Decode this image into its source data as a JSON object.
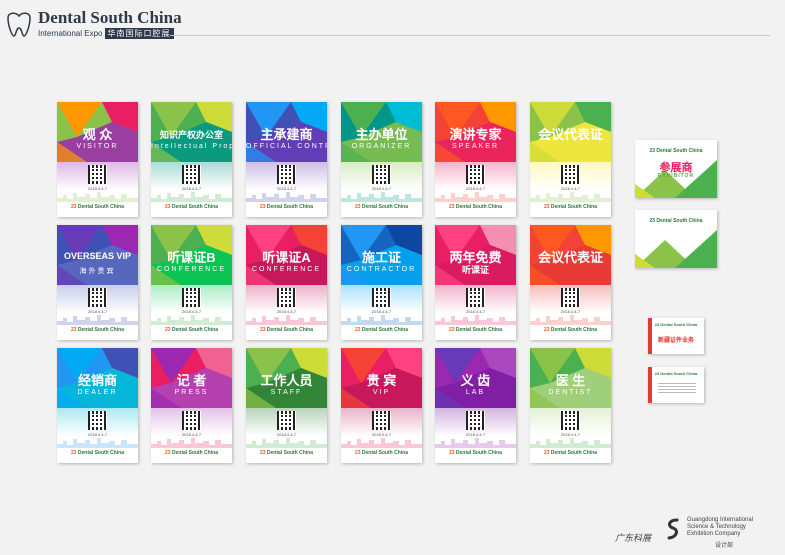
{
  "header": {
    "left_text_1": "Dental",
    "left_text_2": "South",
    "left_text_3": "China",
    "title": "Dental South China",
    "subtitle": "International Expo",
    "subtitle_cn": "华南国际口腔展"
  },
  "cards": [
    {
      "title": "观  众",
      "sub": "VISITOR",
      "colors": [
        "#8bc34a",
        "#ff9800",
        "#e91e63",
        "#9c27b0"
      ]
    },
    {
      "title": "知识产权办公室",
      "sub": "Intellectual Property Rights Office",
      "small": true,
      "colors": [
        "#4caf50",
        "#8bc34a",
        "#cddc39",
        "#009688"
      ]
    },
    {
      "title": "主承建商",
      "sub": "OFFICIAL CONTRACTOR",
      "colors": [
        "#3f51b5",
        "#2196f3",
        "#03a9f4",
        "#673ab7"
      ]
    },
    {
      "title": "主办单位",
      "sub": "ORGANIZER",
      "colors": [
        "#009688",
        "#4caf50",
        "#00bcd4",
        "#8bc34a"
      ]
    },
    {
      "title": "演讲专家",
      "sub": "SPEAKER",
      "colors": [
        "#f44336",
        "#ff5722",
        "#ff9800",
        "#e91e63"
      ]
    },
    {
      "title": "会议代表证",
      "sub": "",
      "colors": [
        "#8bc34a",
        "#cddc39",
        "#4caf50",
        "#ffeb3b"
      ]
    },
    {
      "title": "OVERSEAS VIP",
      "sub": "海外贵宾",
      "small": true,
      "colors": [
        "#3f51b5",
        "#673ab7",
        "#9c27b0",
        "#5c6bc0"
      ]
    },
    {
      "title": "听课证B",
      "sub": "CONFERENCE",
      "colors": [
        "#4caf50",
        "#8bc34a",
        "#cddc39",
        "#00c853"
      ]
    },
    {
      "title": "听课证A",
      "sub": "CONFERENCE",
      "colors": [
        "#e91e63",
        "#ff4081",
        "#f44336",
        "#c2185b"
      ]
    },
    {
      "title": "施工证",
      "sub": "CONTRACTOR",
      "colors": [
        "#1565c0",
        "#2196f3",
        "#0d47a1",
        "#03a9f4"
      ]
    },
    {
      "title": "两年免费",
      "sub": "",
      "extra": "听课证",
      "colors": [
        "#e91e63",
        "#ff4081",
        "#f48fb1",
        "#d81b60"
      ]
    },
    {
      "title": "会议代表证",
      "sub": "",
      "colors": [
        "#f44336",
        "#ff5722",
        "#ff9800",
        "#e53935"
      ]
    },
    {
      "title": "经销商",
      "sub": "DEALER",
      "colors": [
        "#2196f3",
        "#03a9f4",
        "#3f51b5",
        "#00bcd4"
      ]
    },
    {
      "title": "记  者",
      "sub": "PRESS",
      "colors": [
        "#e91e63",
        "#9c27b0",
        "#f06292",
        "#ab47bc"
      ]
    },
    {
      "title": "工作人员",
      "sub": "STAFF",
      "colors": [
        "#4caf50",
        "#8bc34a",
        "#cddc39",
        "#2e7d32"
      ]
    },
    {
      "title": "贵  宾",
      "sub": "VIP",
      "colors": [
        "#e91e63",
        "#f44336",
        "#ff4081",
        "#c2185b"
      ]
    },
    {
      "title": "义  齿",
      "sub": "LAB",
      "colors": [
        "#9c27b0",
        "#673ab7",
        "#ab47bc",
        "#7b1fa2"
      ]
    },
    {
      "title": "医  生",
      "sub": "DENTIST",
      "colors": [
        "#4caf50",
        "#8bc34a",
        "#cddc39",
        "#aed581"
      ]
    }
  ],
  "card_common": {
    "date": "2018.4.4-7",
    "brand_num": "23",
    "brand_name": "Dental South China"
  },
  "minis": [
    {
      "title": "参展商",
      "sub": "EXHIBITOR"
    },
    {
      "title": "",
      "sub": ""
    },
    {
      "title": "新疆证件业务",
      "sub": ""
    },
    {
      "title": "",
      "sub": ""
    }
  ],
  "footer": {
    "name_cn": "广东科展",
    "en_1": "Guangdong International",
    "en_2": "Science & Technology",
    "en_3": "Exhibition Company",
    "dept": "设计部"
  }
}
